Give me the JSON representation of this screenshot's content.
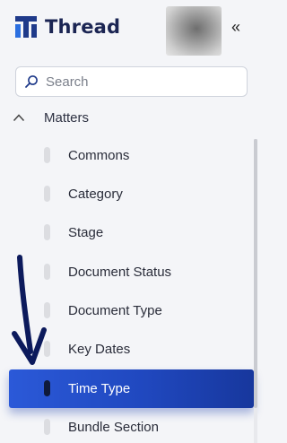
{
  "app": {
    "name": "Thread",
    "collapse_glyph": "«",
    "brand_color": "#1f3a8a"
  },
  "search": {
    "placeholder": "Search",
    "value": ""
  },
  "nav": {
    "section_label": "Matters",
    "section_expanded": true,
    "items": [
      {
        "label": "Commons",
        "active": false
      },
      {
        "label": "Category",
        "active": false
      },
      {
        "label": "Stage",
        "active": false
      },
      {
        "label": "Document Status",
        "active": false
      },
      {
        "label": "Document Type",
        "active": false
      },
      {
        "label": "Key Dates",
        "active": false
      },
      {
        "label": "Time Type",
        "active": true
      },
      {
        "label": "Bundle Section",
        "active": false
      }
    ],
    "active_color": "#2452cf"
  },
  "icons": {
    "logo": "thread-logo-icon",
    "search": "search-icon",
    "section_chevron": "chevron-up-icon",
    "collapse": "double-chevron-left-icon"
  }
}
